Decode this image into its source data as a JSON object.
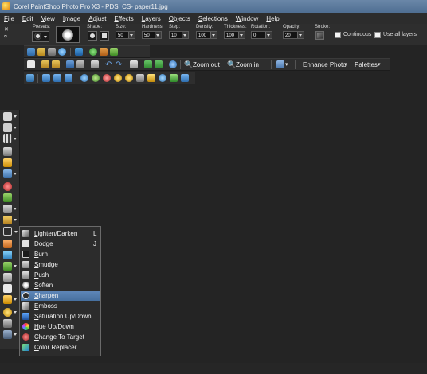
{
  "window": {
    "title": "Corel PaintShop Photo Pro X3 - PDS_CS- paper11.jpg"
  },
  "menu": [
    "File",
    "Edit",
    "View",
    "Image",
    "Adjust",
    "Effects",
    "Layers",
    "Objects",
    "Selections",
    "Window",
    "Help"
  ],
  "tool_options": {
    "presets_label": "Presets:",
    "shape_label": "Shape:",
    "size_label": "Size:",
    "size_value": "50",
    "hardness_label": "Hardness:",
    "hardness_value": "50",
    "step_label": "Step:",
    "step_value": "10",
    "density_label": "Density:",
    "density_value": "100",
    "thickness_label": "Thickness:",
    "thickness_value": "100",
    "rotation_label": "Rotation:",
    "rotation_value": "0",
    "opacity_label": "Opacity:",
    "opacity_value": "20",
    "stroke_label": "Stroke:",
    "continuous_label": "Continuous",
    "use_all_layers_label": "Use all layers"
  },
  "standard_toolbar": {
    "zoom_out_label": "Zoom out",
    "zoom_in_label": "Zoom in",
    "enhance_photo_label": "Enhance Photo",
    "palettes_label": "Palettes"
  },
  "flyout": {
    "items": [
      {
        "label": "Lighten/Darken",
        "key": "L",
        "icon": "lighten-darken-icon"
      },
      {
        "label": "Dodge",
        "key": "J",
        "icon": "dodge-icon"
      },
      {
        "label": "Burn",
        "key": "",
        "icon": "burn-icon"
      },
      {
        "label": "Smudge",
        "key": "",
        "icon": "smudge-icon"
      },
      {
        "label": "Push",
        "key": "",
        "icon": "push-icon"
      },
      {
        "label": "Soften",
        "key": "",
        "icon": "soften-icon"
      },
      {
        "label": "Sharpen",
        "key": "",
        "icon": "sharpen-icon",
        "selected": true
      },
      {
        "label": "Emboss",
        "key": "",
        "icon": "emboss-icon"
      },
      {
        "label": "Saturation Up/Down",
        "key": "",
        "icon": "saturation-icon"
      },
      {
        "label": "Hue Up/Down",
        "key": "",
        "icon": "hue-icon"
      },
      {
        "label": "Change To Target",
        "key": "",
        "icon": "change-to-target-icon"
      },
      {
        "label": "Color Replacer",
        "key": "",
        "icon": "color-replacer-icon"
      }
    ]
  },
  "colors": {
    "selection": "#5e86b8",
    "background": "#242424",
    "toolbar": "#2e2e2e"
  }
}
